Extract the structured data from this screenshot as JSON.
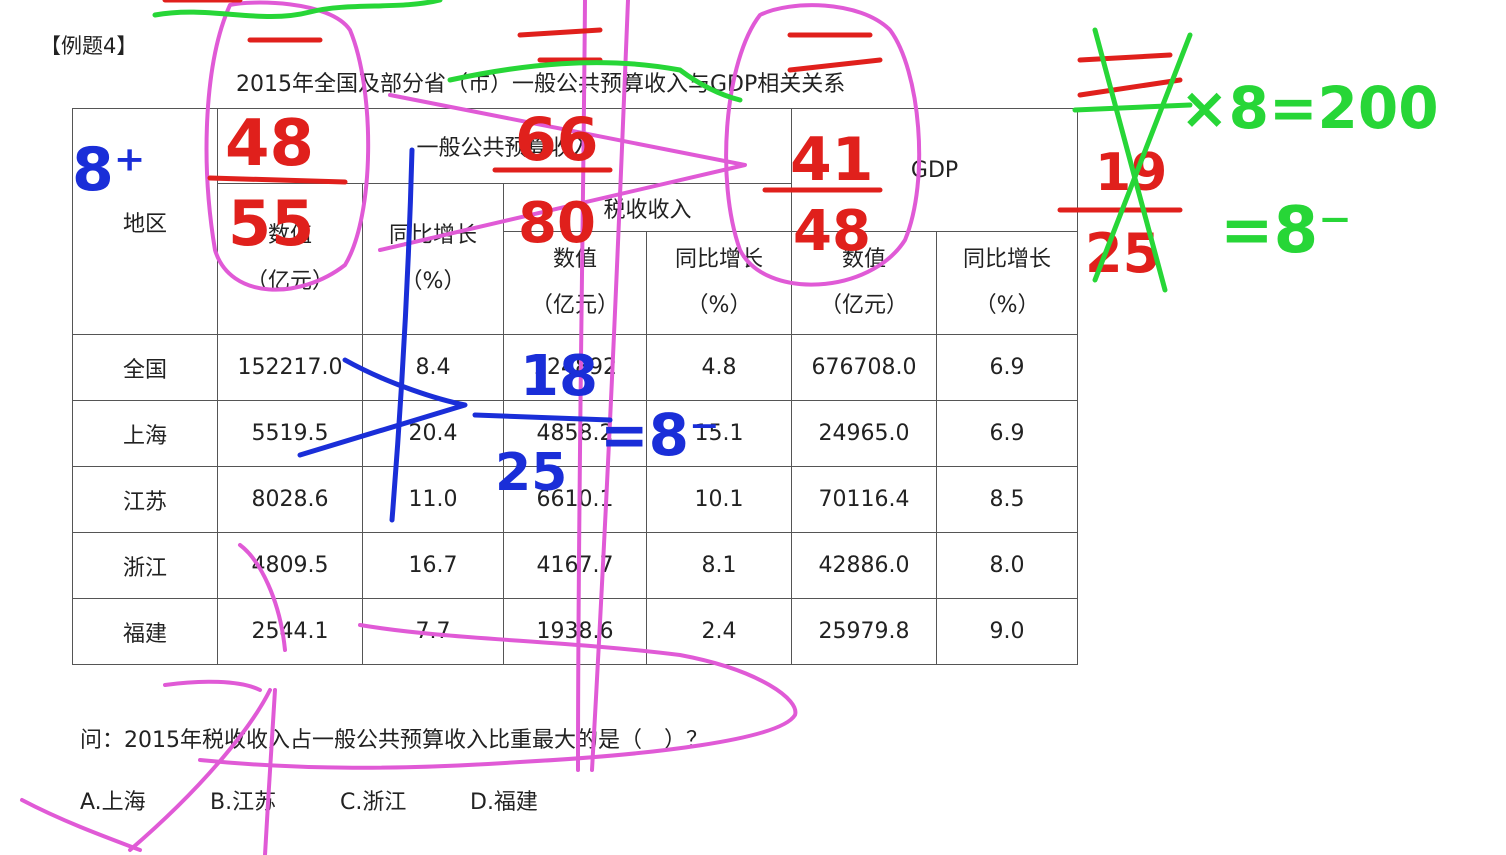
{
  "example_label": "【例题4】",
  "table_title": "2015年全国及部分省（市）一般公共预算收入与GDP相关关系",
  "table": {
    "col_region": "地区",
    "group_budget": "一般公共预算收入",
    "group_tax": "税收收入",
    "group_gdp": "GDP",
    "value_label": "数值",
    "value_unit": "（亿元）",
    "growth_label": "同比增长",
    "growth_unit": "（%）",
    "rows": [
      {
        "region": "全国",
        "budget": "152217.0",
        "budget_growth": "8.4",
        "tax": "124892",
        "tax_growth": "4.8",
        "gdp": "676708.0",
        "gdp_growth": "6.9"
      },
      {
        "region": "上海",
        "budget": "5519.5",
        "budget_growth": "20.4",
        "tax": "4858.2",
        "tax_growth": "15.1",
        "gdp": "24965.0",
        "gdp_growth": "6.9"
      },
      {
        "region": "江苏",
        "budget": "8028.6",
        "budget_growth": "11.0",
        "tax": "6610.1",
        "tax_growth": "10.1",
        "gdp": "70116.4",
        "gdp_growth": "8.5"
      },
      {
        "region": "浙江",
        "budget": "4809.5",
        "budget_growth": "16.7",
        "tax": "4167.7",
        "tax_growth": "8.1",
        "gdp": "42886.0",
        "gdp_growth": "8.0"
      },
      {
        "region": "福建",
        "budget": "2544.1",
        "budget_growth": "7.7",
        "tax": "1938.6",
        "tax_growth": "2.4",
        "gdp": "25979.8",
        "gdp_growth": "9.0"
      }
    ]
  },
  "question": "问：2015年税收收入占一般公共预算收入比重最大的是（　）？",
  "options": [
    "A.上海",
    "B.江苏",
    "C.浙江",
    "D.福建"
  ],
  "annotations": {
    "red_fraction_1_num": "48",
    "red_fraction_1_den": "55",
    "red_fraction_2_num": "66",
    "red_fraction_2_den": "80",
    "red_fraction_3_num": "41",
    "red_fraction_3_den": "48",
    "red_fraction_4_num": "19",
    "red_fraction_4_den": "25",
    "blue_prefix": "8⁺",
    "blue_fraction_num": "18",
    "blue_fraction_den": "25",
    "blue_result": "=8⁻",
    "green_calc_1": "×8=200",
    "green_calc_2": "=8⁻"
  },
  "colors": {
    "pink": "#e05ad6",
    "red": "#e0201c",
    "green": "#27d637",
    "blue": "#1a2ed8"
  }
}
